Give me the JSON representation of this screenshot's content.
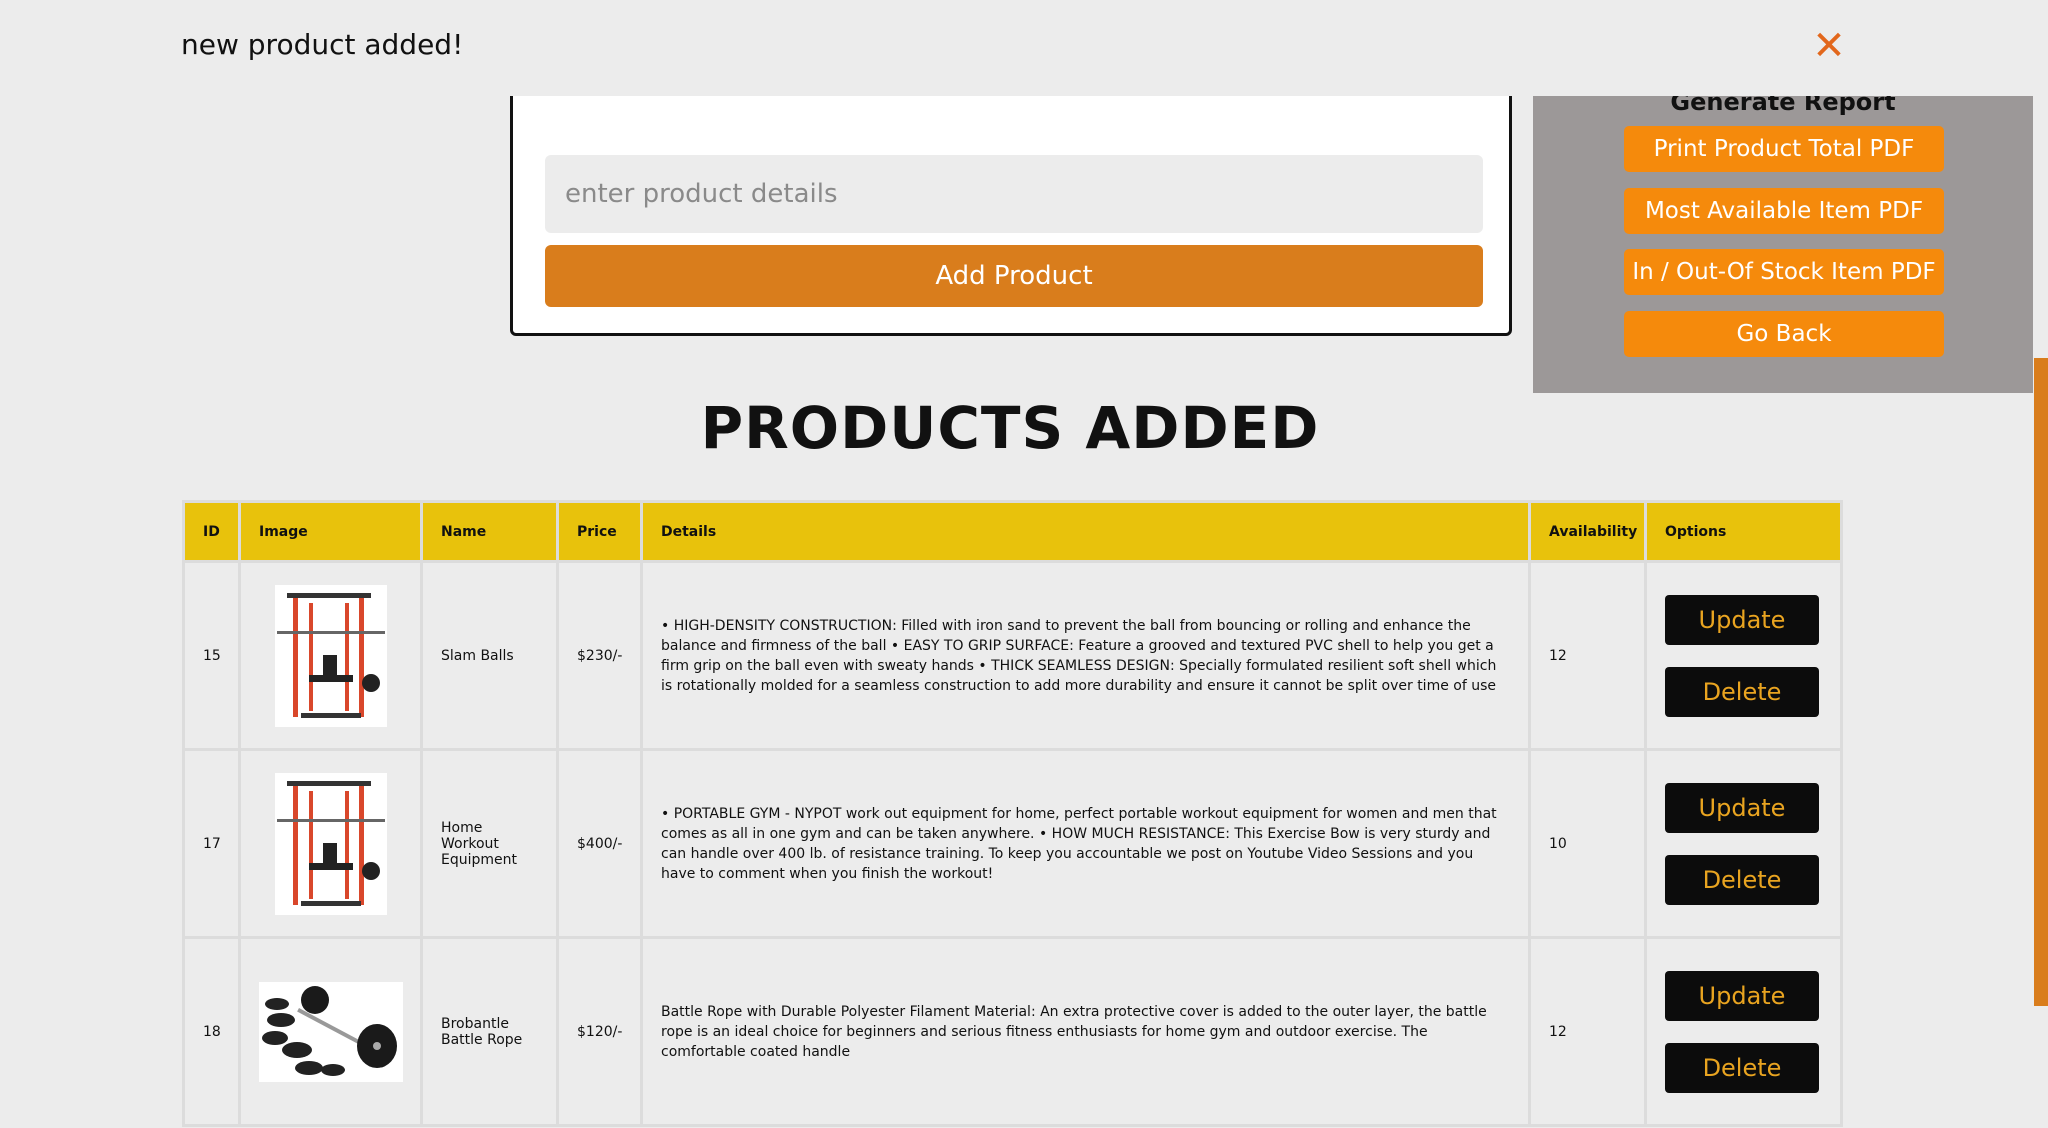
{
  "toast": {
    "message": "new product added!",
    "close_symbol": "✕"
  },
  "form": {
    "details_placeholder": "enter product details",
    "add_button_label": "Add Product"
  },
  "report": {
    "title": "Generate Report",
    "buttons": [
      "Print Product Total PDF",
      "Most Available Item PDF",
      "In / Out-Of Stock Item PDF",
      "Go Back"
    ]
  },
  "products_heading": "PRODUCTS ADDED",
  "table": {
    "headers": [
      "ID",
      "Image",
      "Name",
      "Price",
      "Details",
      "Availability",
      "Options"
    ],
    "update_label": "Update",
    "delete_label": "Delete",
    "rows": [
      {
        "id": "15",
        "image": "power-rack-image",
        "name": "Slam Balls",
        "price": "$230/-",
        "details": "• HIGH-DENSITY CONSTRUCTION: Filled with iron sand to prevent the ball from bouncing or rolling and enhance the balance and firmness of the ball • EASY TO GRIP SURFACE: Feature a grooved and textured PVC shell to help you get a firm grip on the ball even with sweaty hands • THICK SEAMLESS DESIGN: Specially formulated resilient soft shell which is rotationally molded for a seamless construction to add more durability and ensure it cannot be split over time of use",
        "availability": "12"
      },
      {
        "id": "17",
        "image": "power-rack-image",
        "name": "Home Workout Equipment",
        "price": "$400/-",
        "details": "• PORTABLE GYM - NYPOT work out equipment for home, perfect portable workout equipment for women and men that comes as all in one gym and can be taken anywhere. • HOW MUCH RESISTANCE: This Exercise Bow is very sturdy and can handle over 400 lb. of resistance training. To keep you accountable we post on Youtube Video Sessions and you have to comment when you finish the workout!",
        "availability": "10"
      },
      {
        "id": "18",
        "image": "barbell-plates-image",
        "name": "Brobantle Battle Rope",
        "price": "$120/-",
        "details": "Battle Rope with Durable Polyester Filament Material: An extra protective cover is added to the outer layer, the battle rope is an ideal choice for beginners and serious fitness enthusiasts for home gym and outdoor exercise. The comfortable coated handle",
        "availability": "12"
      }
    ]
  },
  "colors": {
    "background": "#ececec",
    "accent_orange": "#d97d1c",
    "report_button": "#f58a0c",
    "table_header": "#e8c20c",
    "option_button_bg": "#0c0c0c",
    "option_button_text": "#e9a420",
    "close_icon": "#e2671c"
  }
}
